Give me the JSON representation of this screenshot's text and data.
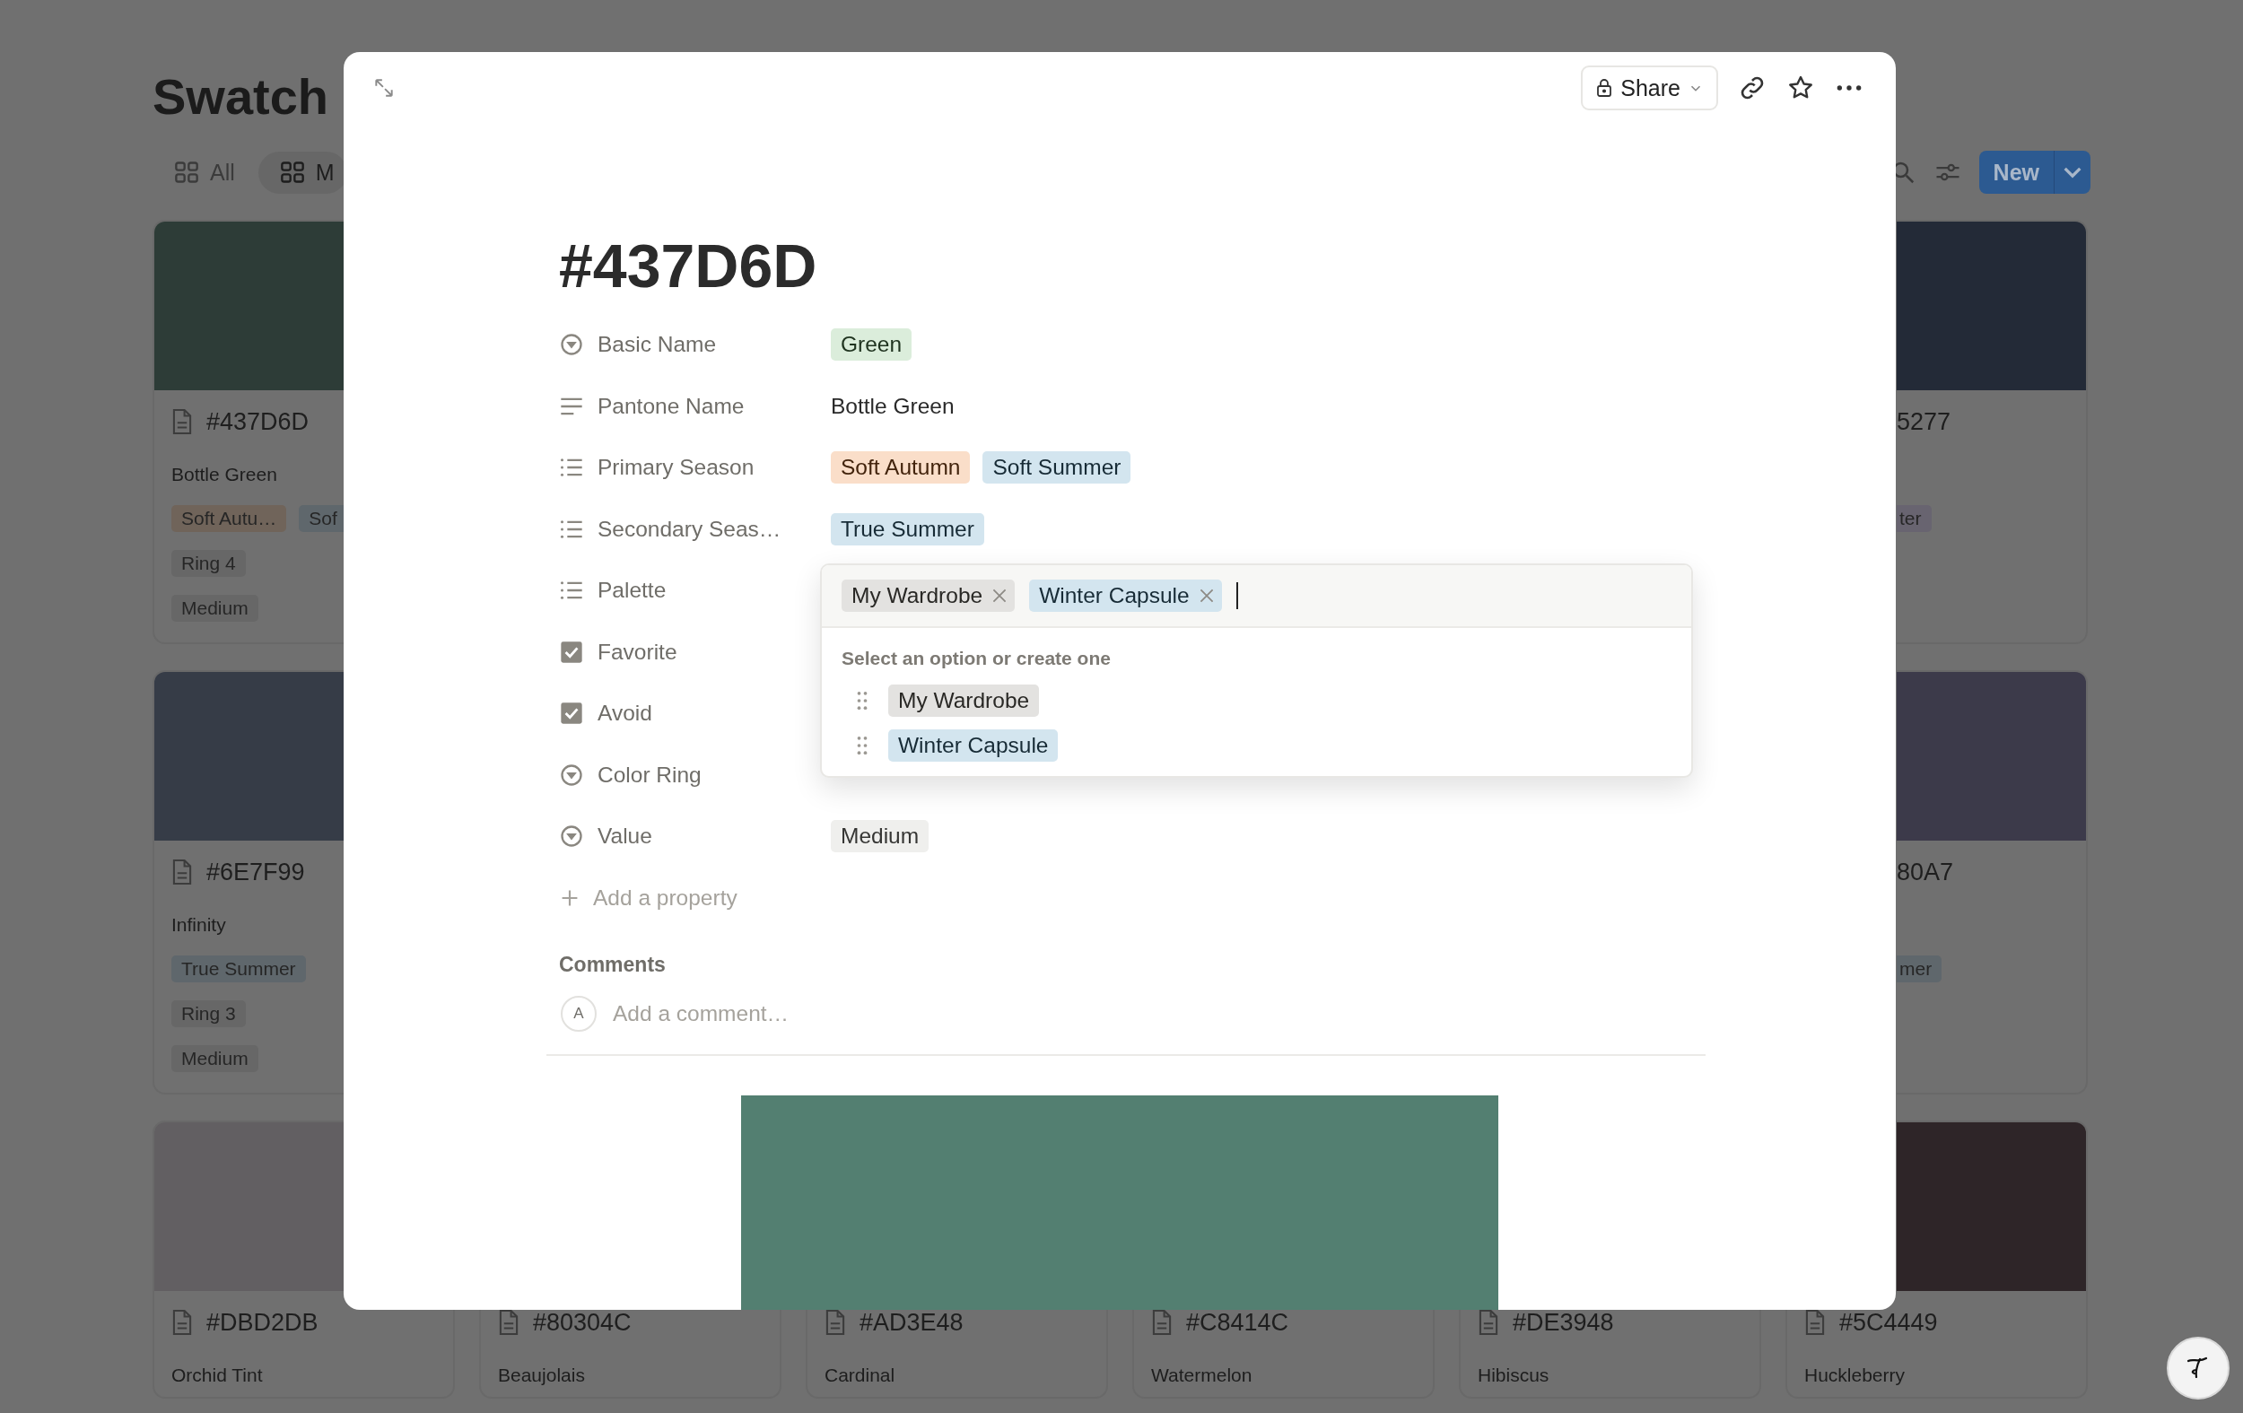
{
  "page": {
    "title": "Swatch",
    "views": [
      {
        "label": "All",
        "selected": false
      },
      {
        "label": "M",
        "selected": true
      }
    ],
    "new_button": "New"
  },
  "card_rows": [
    {
      "cards": [
        {
          "kind": "left_edge",
          "color": "#2d3c37",
          "hex": "#437D6D",
          "name": "Bottle Green",
          "tag_lines": [
            [
              {
                "text": "Soft Autu…",
                "color": "#70645a"
              },
              {
                "text": "Sof",
                "color": "#5f676c"
              }
            ],
            [
              {
                "text": "Ring 4",
                "color": "#676767"
              }
            ],
            [
              {
                "text": "Medium",
                "color": "#676767"
              }
            ]
          ]
        },
        {
          "kind": "right_edge",
          "color": "#232a37",
          "hex": "5277",
          "tag_lines": [
            [
              {
                "text": "ter",
                "color": "#686470"
              }
            ]
          ]
        }
      ]
    },
    {
      "cards": [
        {
          "kind": "left_edge",
          "color": "#363c47",
          "hex": "#6E7F99",
          "name": "Infinity",
          "tag_lines": [
            [
              {
                "text": "True Summer",
                "color": "#5f676c"
              }
            ],
            [
              {
                "text": "Ring 3",
                "color": "#676767"
              }
            ],
            [
              {
                "text": "Medium",
                "color": "#676767"
              }
            ]
          ]
        },
        {
          "kind": "right_edge",
          "color": "#3c3a4a",
          "hex": "80A7",
          "tag_lines": [
            [
              {
                "text": "mer",
                "color": "#5f676c"
              }
            ]
          ]
        }
      ]
    },
    {
      "cards": [
        {
          "kind": "bottom_left",
          "color": "#625f62",
          "hex": "#DBD2DB",
          "name": "Orchid Tint"
        },
        {
          "kind": "bottom",
          "hex": "#80304C",
          "name": "Beaujolais"
        },
        {
          "kind": "bottom",
          "hex": "#AD3E48",
          "name": "Cardinal"
        },
        {
          "kind": "bottom",
          "hex": "#C8414C",
          "name": "Watermelon"
        },
        {
          "kind": "bottom",
          "hex": "#DE3948",
          "name": "Hibiscus"
        },
        {
          "kind": "bottom_right",
          "color": "#2e2528",
          "hex": "#5C4449",
          "name": "Huckleberry"
        }
      ]
    }
  ],
  "modal": {
    "share_button": "Share",
    "title": "#437D6D",
    "properties": [
      {
        "kind": "select",
        "label": "Basic Name",
        "values": [
          {
            "text": "Green",
            "color": "#dbeddb"
          }
        ]
      },
      {
        "kind": "text",
        "label": "Pantone Name",
        "value": "Bottle Green"
      },
      {
        "kind": "multi_select",
        "label": "Primary Season",
        "values": [
          {
            "text": "Soft Autumn",
            "color": "#fadec9"
          },
          {
            "text": "Soft Summer",
            "color": "#d3e5ef"
          }
        ]
      },
      {
        "kind": "multi_select",
        "label": "Secondary Seas…",
        "values": [
          {
            "text": "True Summer",
            "color": "#d3e5ef"
          }
        ]
      },
      {
        "kind": "multi_select",
        "label": "Palette"
      },
      {
        "kind": "checkbox",
        "label": "Favorite"
      },
      {
        "kind": "checkbox",
        "label": "Avoid"
      },
      {
        "kind": "select",
        "label": "Color Ring"
      },
      {
        "kind": "select",
        "label": "Value",
        "values": [
          {
            "text": "Medium",
            "color": "#efefed"
          }
        ]
      }
    ],
    "add_property": "Add a property",
    "comments": {
      "heading": "Comments",
      "avatar": "A",
      "placeholder": "Add a comment…"
    },
    "picker": {
      "selected": [
        {
          "text": "My Wardrobe",
          "color": "#e3e2e0"
        },
        {
          "text": "Winter Capsule",
          "color": "#d3e5ef"
        }
      ],
      "hint": "Select an option or create one",
      "options": [
        {
          "text": "My Wardrobe",
          "color": "#e3e2e0"
        },
        {
          "text": "Winter Capsule",
          "color": "#d3e5ef"
        }
      ]
    }
  }
}
